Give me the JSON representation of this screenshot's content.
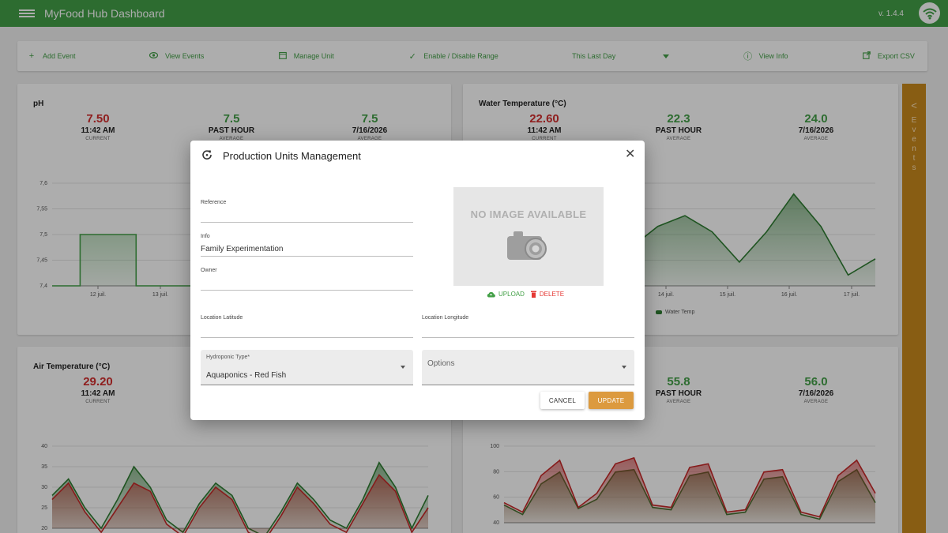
{
  "app": {
    "title": "MyFood Hub Dashboard",
    "version": "v. 1.4.4",
    "brand_color": "#43a047",
    "icons": {
      "menu": "hamburger-icon",
      "wifi": "wifi-icon"
    }
  },
  "toolbar": {
    "add_event": "Add Event",
    "view_events": "View Events",
    "manage_unit": "Manage Unit",
    "enable_disable_range": "Enable / Disable Range",
    "range_select": "This Last Day",
    "view_info": "View Info",
    "export_csv": "Export CSV"
  },
  "cards": {
    "ph": {
      "title": "pH",
      "current": {
        "value": "7.50",
        "label": "11:42 AM",
        "sub": "CURRENT"
      },
      "hour": {
        "value": "7.5",
        "label": "PAST HOUR",
        "sub": "AVERAGE"
      },
      "day": {
        "value": "7.5",
        "label": "7/16/2026",
        "sub": "AVERAGE"
      }
    },
    "water": {
      "title": "Water Temperature (°C)",
      "current": {
        "value": "22.60",
        "label": "11:42 AM",
        "sub": "CURRENT"
      },
      "hour": {
        "value": "22.3",
        "label": "PAST HOUR",
        "sub": "AVERAGE"
      },
      "day": {
        "value": "24.0",
        "label": "7/16/2026",
        "sub": "AVERAGE"
      },
      "legend": "Water Temp"
    },
    "air": {
      "title": "Air Temperature (°C)",
      "current": {
        "value": "29.20",
        "label": "11:42 AM",
        "sub": "CURRENT"
      }
    },
    "humidity": {
      "hour": {
        "value": "55.8",
        "label": "PAST HOUR",
        "sub": "AVERAGE"
      },
      "day": {
        "value": "56.0",
        "label": "7/16/2026",
        "sub": "AVERAGE"
      }
    }
  },
  "events_tab": {
    "arrow": "<",
    "letters": [
      "E",
      "v",
      "e",
      "n",
      "t",
      "s"
    ]
  },
  "dialog": {
    "title": "Production Units Management",
    "fields": {
      "reference": {
        "label": "Reference",
        "value": ""
      },
      "info": {
        "label": "Info",
        "value": "Family Experimentation"
      },
      "owner": {
        "label": "Owner",
        "value": ""
      },
      "latitude": {
        "label": "Location Latitude",
        "value": ""
      },
      "longitude": {
        "label": "Location Longitude",
        "value": ""
      },
      "hydroponic_type": {
        "label": "Hydroponic Type*",
        "value": "Aquaponics - Red Fish"
      },
      "options": {
        "label": "Options"
      }
    },
    "image": {
      "placeholder": "NO IMAGE AVAILABLE",
      "upload": "UPLOAD",
      "delete": "DELETE"
    },
    "cancel": "CANCEL",
    "update": "UPDATE"
  },
  "chart_data": [
    {
      "type": "line",
      "title": "pH",
      "x_ticks": [
        "12 juil.",
        "13 juil."
      ],
      "y_ticks": [
        "7,6",
        "7,55",
        "7,5",
        "7,45",
        "7,4"
      ],
      "ylim": [
        7.4,
        7.6
      ],
      "series": [
        {
          "values": [
            7.4,
            7.5,
            7.5,
            7.4,
            7.4,
            7.4,
            7.4,
            7.4,
            7.4,
            7.5,
            7.5,
            7.5,
            7.6,
            7.6,
            7.6
          ],
          "color": "#43a047"
        }
      ]
    },
    {
      "type": "line",
      "title": "Water Temperature (°C)",
      "x_ticks": [
        "14 juil.",
        "15 juil.",
        "16 juil.",
        "17 juil."
      ],
      "legend": [
        "Water Temp"
      ],
      "series": [
        {
          "name": "Water Temp",
          "values": [
            26,
            22.5,
            25,
            28.2,
            25,
            23.5,
            25.5,
            26.5,
            25,
            22.2,
            25,
            28.5,
            25.5,
            21,
            22.5
          ],
          "color": "#2e7d32"
        }
      ]
    },
    {
      "type": "line",
      "title": "Air Temperature (°C)",
      "y_ticks": [
        "40",
        "35",
        "30",
        "25",
        "20"
      ],
      "ylim": [
        20,
        40
      ],
      "series": [
        {
          "values": [
            28,
            32,
            25,
            20,
            27,
            35,
            30,
            22,
            19,
            26,
            31,
            28,
            20,
            18,
            24,
            31,
            27,
            22,
            20,
            27,
            36,
            30,
            20,
            28
          ],
          "color": "#2e7d32"
        },
        {
          "values": [
            27,
            31,
            24,
            19,
            25,
            31,
            29,
            21,
            18,
            25,
            30,
            27,
            19,
            17,
            23,
            30,
            26,
            21,
            19,
            26,
            33,
            29,
            19,
            25
          ],
          "color": "#c62828"
        }
      ]
    },
    {
      "type": "line",
      "y_ticks": [
        "100",
        "80",
        "60",
        "40"
      ],
      "ylim": [
        35,
        100
      ],
      "series": [
        {
          "values": [
            50,
            42,
            68,
            78,
            47,
            55,
            78,
            80,
            48,
            46,
            75,
            78,
            42,
            44,
            72,
            74,
            42,
            38,
            70,
            80,
            52
          ],
          "color": "#2e7d32"
        },
        {
          "values": [
            52,
            44,
            75,
            88,
            48,
            60,
            85,
            90,
            50,
            48,
            82,
            85,
            44,
            46,
            78,
            80,
            44,
            40,
            75,
            88,
            60
          ],
          "color": "#c62828"
        }
      ]
    }
  ]
}
